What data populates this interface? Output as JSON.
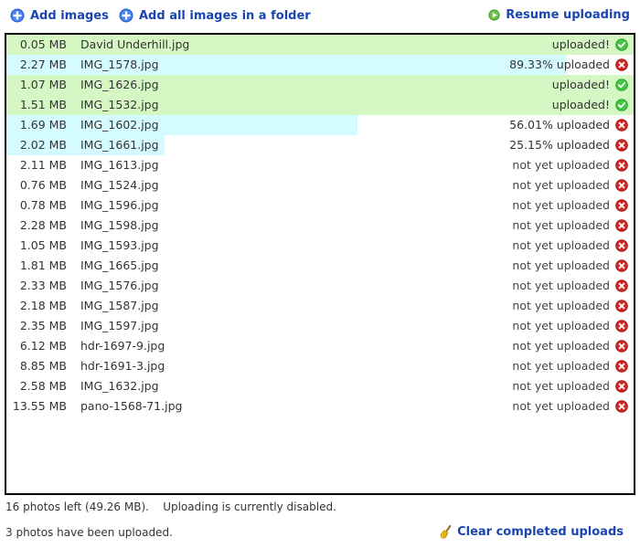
{
  "toolbar": {
    "add_images": "Add images",
    "add_folder": "Add all images in a folder",
    "resume": "Resume uploading"
  },
  "colors": {
    "link": "#1a45b0",
    "uploaded_bg": "#d5f7c3",
    "progress_bg": "#d4fbff",
    "ok_icon": "#2ea82e",
    "remove_icon": "#d62a2a"
  },
  "files": [
    {
      "size": "0.05 MB",
      "name": "David Underhill.jpg",
      "status": "uploaded!",
      "progress": 1.0,
      "state": "done"
    },
    {
      "size": "2.27 MB",
      "name": "IMG_1578.jpg",
      "status": "89.33% uploaded",
      "progress": 0.8933,
      "state": "progress"
    },
    {
      "size": "1.07 MB",
      "name": "IMG_1626.jpg",
      "status": "uploaded!",
      "progress": 1.0,
      "state": "done"
    },
    {
      "size": "1.51 MB",
      "name": "IMG_1532.jpg",
      "status": "uploaded!",
      "progress": 1.0,
      "state": "done"
    },
    {
      "size": "1.69 MB",
      "name": "IMG_1602.jpg",
      "status": "56.01% uploaded",
      "progress": 0.5601,
      "state": "progress"
    },
    {
      "size": "2.02 MB",
      "name": "IMG_1661.jpg",
      "status": "25.15% uploaded",
      "progress": 0.2515,
      "state": "progress"
    },
    {
      "size": "2.11 MB",
      "name": "IMG_1613.jpg",
      "status": "not yet uploaded",
      "progress": 0,
      "state": "pending"
    },
    {
      "size": "0.76 MB",
      "name": "IMG_1524.jpg",
      "status": "not yet uploaded",
      "progress": 0,
      "state": "pending"
    },
    {
      "size": "0.78 MB",
      "name": "IMG_1596.jpg",
      "status": "not yet uploaded",
      "progress": 0,
      "state": "pending"
    },
    {
      "size": "2.28 MB",
      "name": "IMG_1598.jpg",
      "status": "not yet uploaded",
      "progress": 0,
      "state": "pending"
    },
    {
      "size": "1.05 MB",
      "name": "IMG_1593.jpg",
      "status": "not yet uploaded",
      "progress": 0,
      "state": "pending"
    },
    {
      "size": "1.81 MB",
      "name": "IMG_1665.jpg",
      "status": "not yet uploaded",
      "progress": 0,
      "state": "pending"
    },
    {
      "size": "2.33 MB",
      "name": "IMG_1576.jpg",
      "status": "not yet uploaded",
      "progress": 0,
      "state": "pending"
    },
    {
      "size": "2.18 MB",
      "name": "IMG_1587.jpg",
      "status": "not yet uploaded",
      "progress": 0,
      "state": "pending"
    },
    {
      "size": "2.35 MB",
      "name": "IMG_1597.jpg",
      "status": "not yet uploaded",
      "progress": 0,
      "state": "pending"
    },
    {
      "size": "6.12 MB",
      "name": "hdr-1697-9.jpg",
      "status": "not yet uploaded",
      "progress": 0,
      "state": "pending"
    },
    {
      "size": "8.85 MB",
      "name": "hdr-1691-3.jpg",
      "status": "not yet uploaded",
      "progress": 0,
      "state": "pending"
    },
    {
      "size": "2.58 MB",
      "name": "IMG_1632.jpg",
      "status": "not yet uploaded",
      "progress": 0,
      "state": "pending"
    },
    {
      "size": "13.55 MB",
      "name": "pano-1568-71.jpg",
      "status": "not yet uploaded",
      "progress": 0,
      "state": "pending"
    }
  ],
  "footer": {
    "left_info": "16 photos left (49.26 MB).    Uploading is currently disabled.",
    "done_info": "3 photos have been uploaded.",
    "clear": "Clear completed uploads"
  }
}
